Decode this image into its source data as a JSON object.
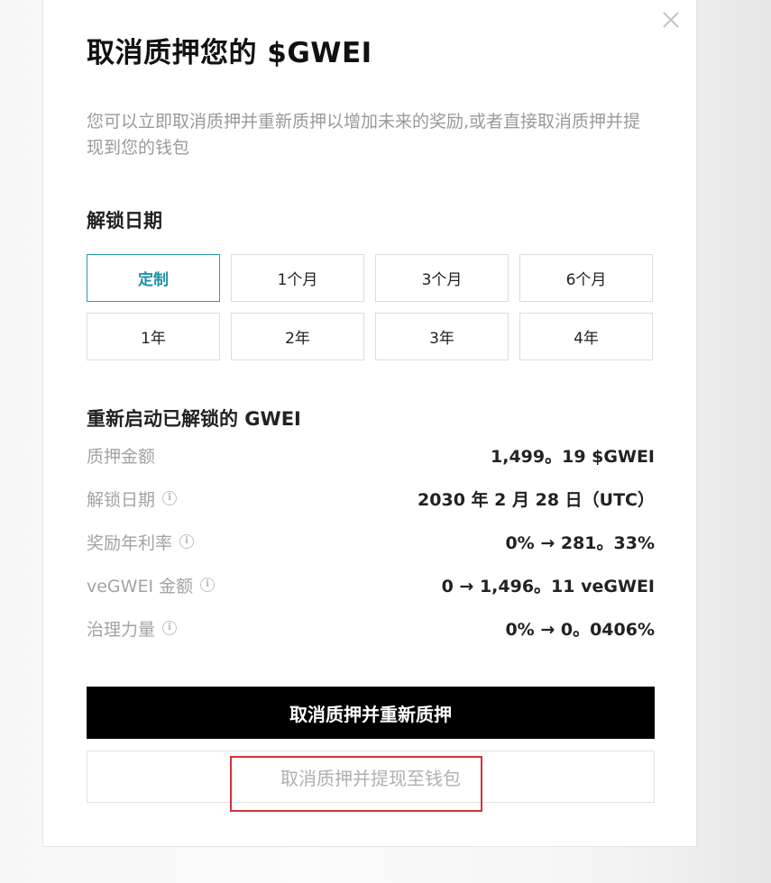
{
  "modal": {
    "title": "取消质押您的 $GWEI",
    "description": "您可以立即取消质押并重新质押以增加未来的奖励,或者直接取消质押并提现到您的钱包"
  },
  "unlock_period": {
    "heading": "解锁日期",
    "options": [
      "定制",
      "1个月",
      "3个月",
      "6个月",
      "1年",
      "2年",
      "3年",
      "4年"
    ],
    "selected": "定制"
  },
  "restake": {
    "heading": "重新启动已解锁的 GWEI",
    "rows": [
      {
        "label": "质押金额",
        "value": "1,499。19 $GWEI"
      },
      {
        "label": "解锁日期",
        "value": "2030 年 2 月 28 日（UTC）"
      },
      {
        "label": "奖励年利率",
        "value": "0% → 281。33%"
      },
      {
        "label": "veGWEI 金额",
        "value": "0 → 1,496。11 veGWEI"
      },
      {
        "label": "治理力量",
        "value": "0% → 0。0406%"
      }
    ]
  },
  "actions": {
    "primary_label": "取消质押并重新质押",
    "secondary_label": "取消质押并提现至钱包"
  },
  "icons": {
    "close": "close-icon",
    "info": "info-icon"
  },
  "colors": {
    "accent": "#2a9cb0",
    "primary_button": "#000000",
    "highlight": "#d0343b"
  }
}
